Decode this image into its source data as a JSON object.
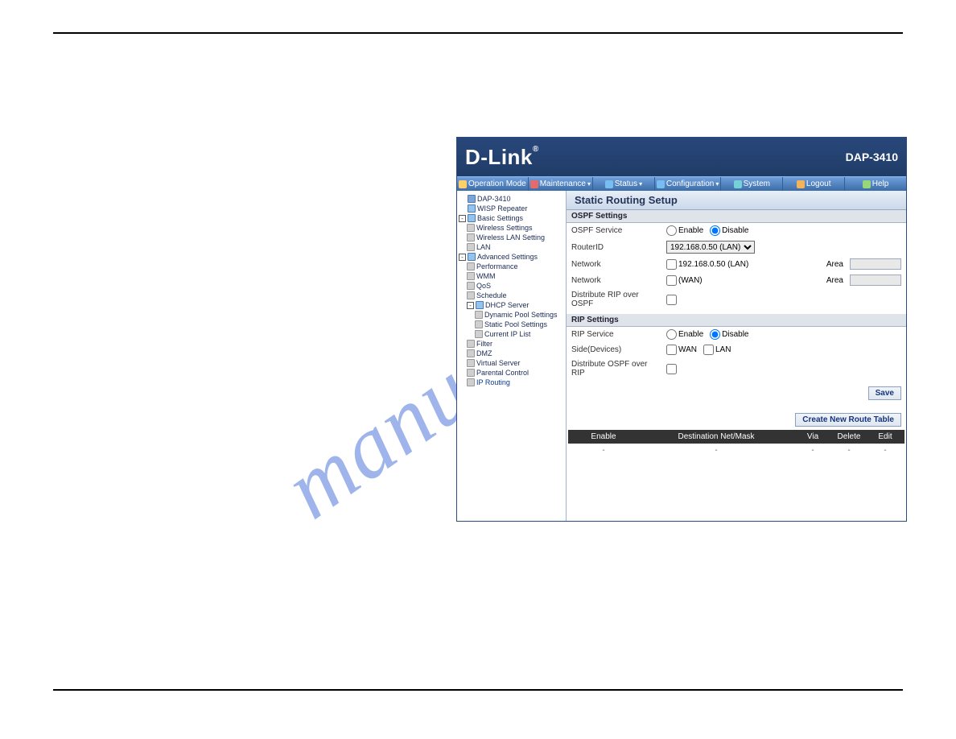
{
  "watermark": "manualslive",
  "banner": {
    "logo": "D-Link",
    "model": "DAP-3410"
  },
  "menubar": {
    "items": [
      {
        "label": "Operation Mode"
      },
      {
        "label": "Maintenance"
      },
      {
        "label": "Status"
      },
      {
        "label": "Configuration"
      },
      {
        "label": "System"
      },
      {
        "label": "Logout"
      },
      {
        "label": "Help"
      }
    ]
  },
  "sidebar": {
    "nodes": [
      {
        "label": "DAP-3410",
        "level": 0
      },
      {
        "label": "WISP Repeater",
        "level": 0
      },
      {
        "label": "Basic Settings",
        "level": 0,
        "exp": "-"
      },
      {
        "label": "Wireless Settings",
        "level": 1
      },
      {
        "label": "Wireless LAN Setting",
        "level": 1
      },
      {
        "label": "LAN",
        "level": 1
      },
      {
        "label": "Advanced Settings",
        "level": 0,
        "exp": "-"
      },
      {
        "label": "Performance",
        "level": 1
      },
      {
        "label": "WMM",
        "level": 1
      },
      {
        "label": "QoS",
        "level": 1
      },
      {
        "label": "Schedule",
        "level": 1
      },
      {
        "label": "DHCP Server",
        "level": 1,
        "exp": "-"
      },
      {
        "label": "Dynamic Pool Settings",
        "level": 2
      },
      {
        "label": "Static Pool Settings",
        "level": 2
      },
      {
        "label": "Current IP List",
        "level": 2
      },
      {
        "label": "Filter",
        "level": 1
      },
      {
        "label": "DMZ",
        "level": 1
      },
      {
        "label": "Virtual Server",
        "level": 1
      },
      {
        "label": "Parental Control",
        "level": 1
      },
      {
        "label": "IP Routing",
        "level": 1,
        "selected": true
      }
    ]
  },
  "content": {
    "title": "Static Routing Setup",
    "ospf": {
      "heading": "OSPF Settings",
      "service_label": "OSPF Service",
      "enable": "Enable",
      "disable": "Disable",
      "routerid_label": "RouterID",
      "routerid_value": "192.168.0.50 (LAN)",
      "network_label": "Network",
      "net_lan": "192.168.0.50 (LAN)",
      "net_wan": "(WAN)",
      "area_label": "Area",
      "distribute_label": "Distribute RIP over OSPF"
    },
    "rip": {
      "heading": "RIP Settings",
      "service_label": "RIP Service",
      "enable": "Enable",
      "disable": "Disable",
      "side_label": "Side(Devices)",
      "wan": "WAN",
      "lan": "LAN",
      "distribute_label": "Distribute OSPF over RIP"
    },
    "save_button": "Save",
    "create_button": "Create New Route Table",
    "table": {
      "headers": {
        "enable": "Enable",
        "dest": "Destination Net/Mask",
        "via": "Via",
        "delete": "Delete",
        "edit": "Edit"
      },
      "row": {
        "c1": "-",
        "c2": "-",
        "c3": "-",
        "c4": "-",
        "c5": "-"
      }
    }
  }
}
